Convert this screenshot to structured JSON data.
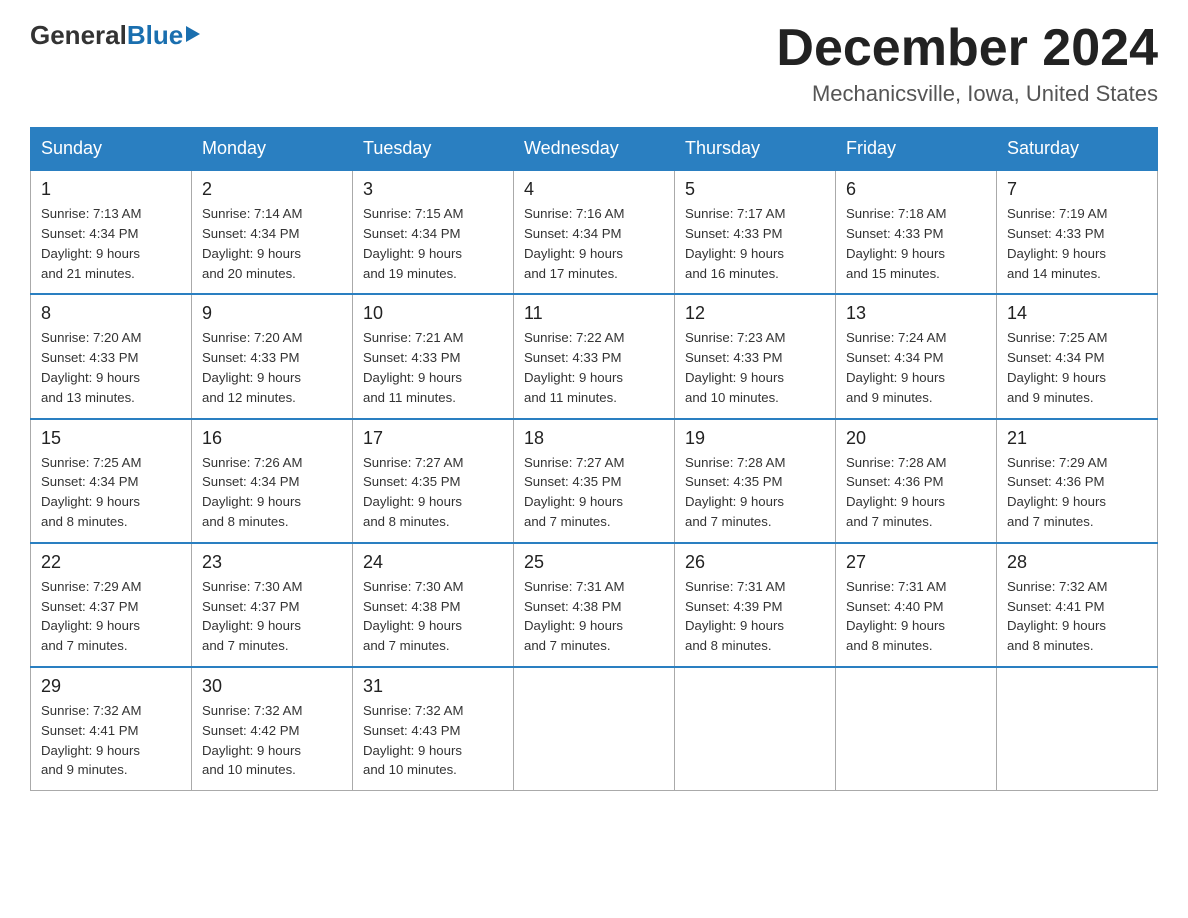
{
  "logo": {
    "general": "General",
    "blue": "Blue"
  },
  "title": {
    "month": "December 2024",
    "location": "Mechanicsville, Iowa, United States"
  },
  "headers": [
    "Sunday",
    "Monday",
    "Tuesday",
    "Wednesday",
    "Thursday",
    "Friday",
    "Saturday"
  ],
  "weeks": [
    [
      {
        "day": "1",
        "sunrise": "7:13 AM",
        "sunset": "4:34 PM",
        "daylight": "9 hours and 21 minutes."
      },
      {
        "day": "2",
        "sunrise": "7:14 AM",
        "sunset": "4:34 PM",
        "daylight": "9 hours and 20 minutes."
      },
      {
        "day": "3",
        "sunrise": "7:15 AM",
        "sunset": "4:34 PM",
        "daylight": "9 hours and 19 minutes."
      },
      {
        "day": "4",
        "sunrise": "7:16 AM",
        "sunset": "4:34 PM",
        "daylight": "9 hours and 17 minutes."
      },
      {
        "day": "5",
        "sunrise": "7:17 AM",
        "sunset": "4:33 PM",
        "daylight": "9 hours and 16 minutes."
      },
      {
        "day": "6",
        "sunrise": "7:18 AM",
        "sunset": "4:33 PM",
        "daylight": "9 hours and 15 minutes."
      },
      {
        "day": "7",
        "sunrise": "7:19 AM",
        "sunset": "4:33 PM",
        "daylight": "9 hours and 14 minutes."
      }
    ],
    [
      {
        "day": "8",
        "sunrise": "7:20 AM",
        "sunset": "4:33 PM",
        "daylight": "9 hours and 13 minutes."
      },
      {
        "day": "9",
        "sunrise": "7:20 AM",
        "sunset": "4:33 PM",
        "daylight": "9 hours and 12 minutes."
      },
      {
        "day": "10",
        "sunrise": "7:21 AM",
        "sunset": "4:33 PM",
        "daylight": "9 hours and 11 minutes."
      },
      {
        "day": "11",
        "sunrise": "7:22 AM",
        "sunset": "4:33 PM",
        "daylight": "9 hours and 11 minutes."
      },
      {
        "day": "12",
        "sunrise": "7:23 AM",
        "sunset": "4:33 PM",
        "daylight": "9 hours and 10 minutes."
      },
      {
        "day": "13",
        "sunrise": "7:24 AM",
        "sunset": "4:34 PM",
        "daylight": "9 hours and 9 minutes."
      },
      {
        "day": "14",
        "sunrise": "7:25 AM",
        "sunset": "4:34 PM",
        "daylight": "9 hours and 9 minutes."
      }
    ],
    [
      {
        "day": "15",
        "sunrise": "7:25 AM",
        "sunset": "4:34 PM",
        "daylight": "9 hours and 8 minutes."
      },
      {
        "day": "16",
        "sunrise": "7:26 AM",
        "sunset": "4:34 PM",
        "daylight": "9 hours and 8 minutes."
      },
      {
        "day": "17",
        "sunrise": "7:27 AM",
        "sunset": "4:35 PM",
        "daylight": "9 hours and 8 minutes."
      },
      {
        "day": "18",
        "sunrise": "7:27 AM",
        "sunset": "4:35 PM",
        "daylight": "9 hours and 7 minutes."
      },
      {
        "day": "19",
        "sunrise": "7:28 AM",
        "sunset": "4:35 PM",
        "daylight": "9 hours and 7 minutes."
      },
      {
        "day": "20",
        "sunrise": "7:28 AM",
        "sunset": "4:36 PM",
        "daylight": "9 hours and 7 minutes."
      },
      {
        "day": "21",
        "sunrise": "7:29 AM",
        "sunset": "4:36 PM",
        "daylight": "9 hours and 7 minutes."
      }
    ],
    [
      {
        "day": "22",
        "sunrise": "7:29 AM",
        "sunset": "4:37 PM",
        "daylight": "9 hours and 7 minutes."
      },
      {
        "day": "23",
        "sunrise": "7:30 AM",
        "sunset": "4:37 PM",
        "daylight": "9 hours and 7 minutes."
      },
      {
        "day": "24",
        "sunrise": "7:30 AM",
        "sunset": "4:38 PM",
        "daylight": "9 hours and 7 minutes."
      },
      {
        "day": "25",
        "sunrise": "7:31 AM",
        "sunset": "4:38 PM",
        "daylight": "9 hours and 7 minutes."
      },
      {
        "day": "26",
        "sunrise": "7:31 AM",
        "sunset": "4:39 PM",
        "daylight": "9 hours and 8 minutes."
      },
      {
        "day": "27",
        "sunrise": "7:31 AM",
        "sunset": "4:40 PM",
        "daylight": "9 hours and 8 minutes."
      },
      {
        "day": "28",
        "sunrise": "7:32 AM",
        "sunset": "4:41 PM",
        "daylight": "9 hours and 8 minutes."
      }
    ],
    [
      {
        "day": "29",
        "sunrise": "7:32 AM",
        "sunset": "4:41 PM",
        "daylight": "9 hours and 9 minutes."
      },
      {
        "day": "30",
        "sunrise": "7:32 AM",
        "sunset": "4:42 PM",
        "daylight": "9 hours and 10 minutes."
      },
      {
        "day": "31",
        "sunrise": "7:32 AM",
        "sunset": "4:43 PM",
        "daylight": "9 hours and 10 minutes."
      },
      null,
      null,
      null,
      null
    ]
  ],
  "labels": {
    "sunrise": "Sunrise:",
    "sunset": "Sunset:",
    "daylight": "Daylight:"
  }
}
